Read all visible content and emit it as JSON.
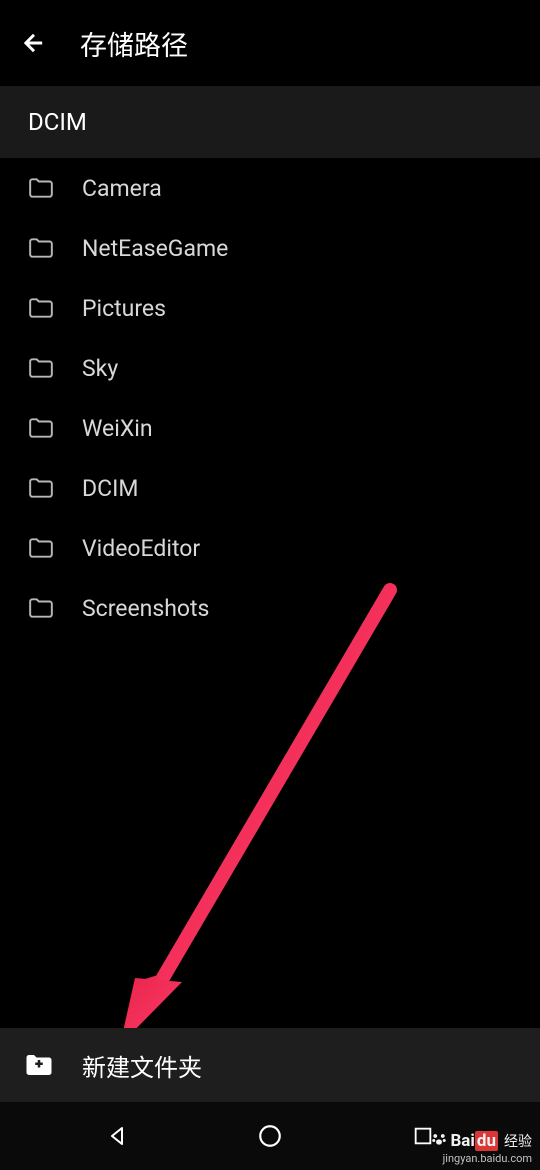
{
  "header": {
    "title": "存储路径"
  },
  "breadcrumb": {
    "current": "DCIM"
  },
  "folders": [
    {
      "name": "Camera"
    },
    {
      "name": "NetEaseGame"
    },
    {
      "name": "Pictures"
    },
    {
      "name": "Sky"
    },
    {
      "name": "WeiXin"
    },
    {
      "name": "DCIM"
    },
    {
      "name": "VideoEditor"
    },
    {
      "name": "Screenshots"
    }
  ],
  "bottom": {
    "new_folder_label": "新建文件夹"
  },
  "watermark": {
    "brand_prefix": "Bai",
    "brand_highlight": "du",
    "brand_suffix": "经验",
    "url": "jingyan.baidu.com"
  }
}
